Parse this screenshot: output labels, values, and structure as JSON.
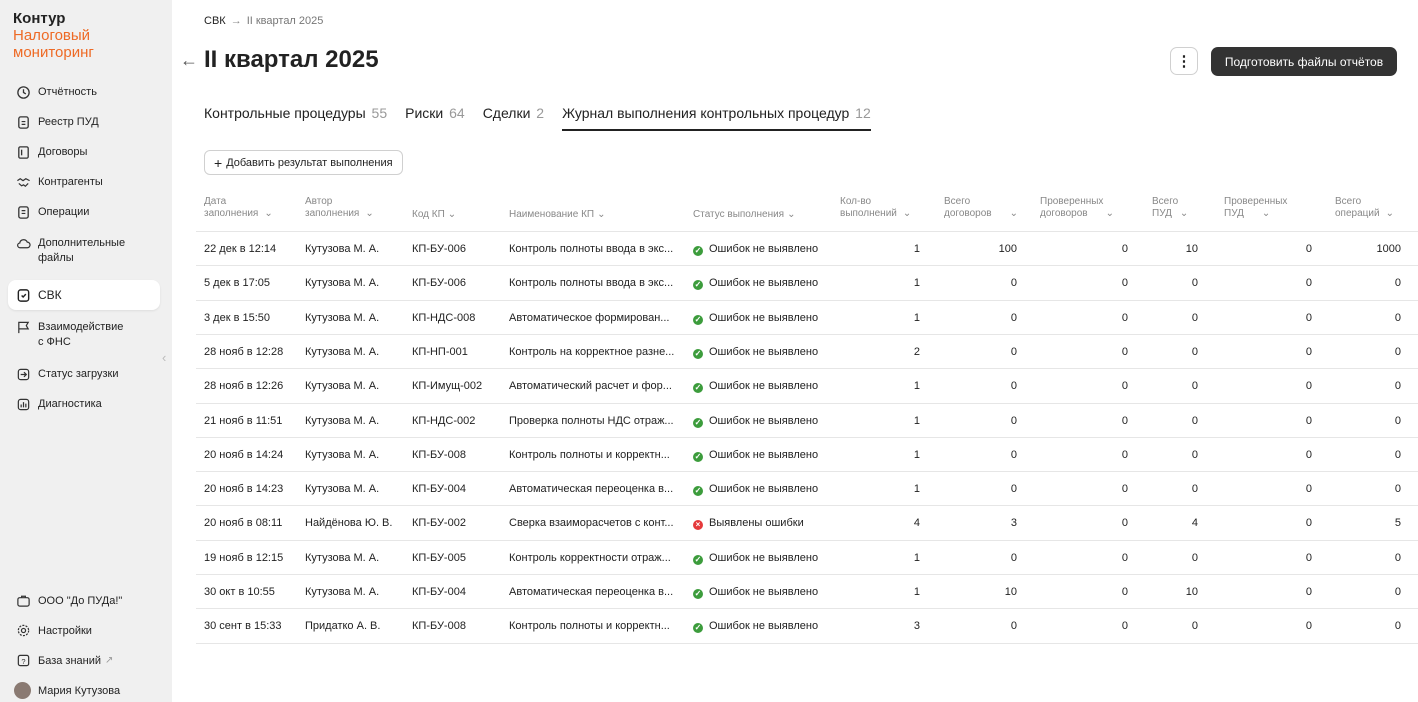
{
  "brand": {
    "line1": "Контур",
    "line2": "Налоговый",
    "line3": "мониторинг"
  },
  "sidebar": {
    "items": [
      {
        "label": "Отчётность",
        "icon": "clock-icon"
      },
      {
        "label": "Реестр ПУД",
        "icon": "document-icon"
      },
      {
        "label": "Договоры",
        "icon": "contract-icon"
      },
      {
        "label": "Контрагенты",
        "icon": "handshake-icon"
      },
      {
        "label": "Операции",
        "icon": "operations-icon"
      },
      {
        "label1": "Дополнительные",
        "label2": "файлы",
        "icon": "cloud-icon"
      },
      {
        "label": "СВК",
        "icon": "svk-icon"
      },
      {
        "label1": "Взаимодействие",
        "label2": "с ФНС",
        "icon": "flag-icon"
      },
      {
        "label": "Статус загрузки",
        "icon": "upload-icon"
      },
      {
        "label": "Диагностика",
        "icon": "chart-icon"
      }
    ],
    "bottom": {
      "org": "ООО \"До ПУДа!\"",
      "settings": "Настройки",
      "knowledge": "База знаний",
      "user": "Мария Кутузова"
    }
  },
  "breadcrumb": {
    "root": "СВК",
    "current": "II квартал 2025"
  },
  "title": "II квартал 2025",
  "actions": {
    "prepare": "Подготовить файлы отчётов"
  },
  "tabs": [
    {
      "label": "Контрольные процедуры",
      "count": "55"
    },
    {
      "label": "Риски",
      "count": "64"
    },
    {
      "label": "Сделки",
      "count": "2"
    },
    {
      "label": "Журнал выполнения контрольных процедур",
      "count": "12"
    }
  ],
  "add_button": "Добавить результат выполнения",
  "headers": [
    [
      "Дата",
      "заполнения"
    ],
    [
      "Автор",
      "заполнения"
    ],
    [
      "Код КП",
      ""
    ],
    [
      "Наименование КП",
      ""
    ],
    [
      "Статус выполнения",
      ""
    ],
    [
      "Кол-во",
      "выполнений"
    ],
    [
      "Всего",
      "договоров"
    ],
    [
      "Проверенных",
      "договоров"
    ],
    [
      "Всего",
      "ПУД"
    ],
    [
      "Проверенных",
      "ПУД"
    ],
    [
      "Всего",
      "операций"
    ]
  ],
  "rows": [
    [
      "22 дек в 12:14",
      "Кутузова М. А.",
      "КП-БУ-006",
      "Контроль полноты ввода в экс...",
      "ok",
      "Ошибок не выявлено",
      "1",
      "100",
      "0",
      "10",
      "0",
      "1000"
    ],
    [
      "5 дек в 17:05",
      "Кутузова М. А.",
      "КП-БУ-006",
      "Контроль полноты ввода в экс...",
      "ok",
      "Ошибок не выявлено",
      "1",
      "0",
      "0",
      "0",
      "0",
      "0"
    ],
    [
      "3 дек в 15:50",
      "Кутузова М. А.",
      "КП-НДС-008",
      "Автоматическое формирован...",
      "ok",
      "Ошибок не выявлено",
      "1",
      "0",
      "0",
      "0",
      "0",
      "0"
    ],
    [
      "28 нояб в 12:28",
      "Кутузова М. А.",
      "КП-НП-001",
      "Контроль на корректное разне...",
      "ok",
      "Ошибок не выявлено",
      "2",
      "0",
      "0",
      "0",
      "0",
      "0"
    ],
    [
      "28 нояб в 12:26",
      "Кутузова М. А.",
      "КП-Имущ-002",
      "Автоматический расчет и фор...",
      "ok",
      "Ошибок не выявлено",
      "1",
      "0",
      "0",
      "0",
      "0",
      "0"
    ],
    [
      "21 нояб в 11:51",
      "Кутузова М. А.",
      "КП-НДС-002",
      "Проверка полноты НДС отраж...",
      "ok",
      "Ошибок не выявлено",
      "1",
      "0",
      "0",
      "0",
      "0",
      "0"
    ],
    [
      "20 нояб в 14:24",
      "Кутузова М. А.",
      "КП-БУ-008",
      "Контроль полноты и корректн...",
      "ok",
      "Ошибок не выявлено",
      "1",
      "0",
      "0",
      "0",
      "0",
      "0"
    ],
    [
      "20 нояб в 14:23",
      "Кутузова М. А.",
      "КП-БУ-004",
      "Автоматическая переоценка в...",
      "ok",
      "Ошибок не выявлено",
      "1",
      "0",
      "0",
      "0",
      "0",
      "0"
    ],
    [
      "20 нояб в 08:11",
      "Найдёнова Ю. В.",
      "КП-БУ-002",
      "Сверка взаиморасчетов с конт...",
      "err",
      "Выявлены ошибки",
      "4",
      "3",
      "0",
      "4",
      "0",
      "5"
    ],
    [
      "19 нояб в 12:15",
      "Кутузова М. А.",
      "КП-БУ-005",
      "Контроль корректности отраж...",
      "ok",
      "Ошибок не выявлено",
      "1",
      "0",
      "0",
      "0",
      "0",
      "0"
    ],
    [
      "30 окт в 10:55",
      "Кутузова М. А.",
      "КП-БУ-004",
      "Автоматическая переоценка в...",
      "ok",
      "Ошибок не выявлено",
      "1",
      "10",
      "0",
      "10",
      "0",
      "0"
    ],
    [
      "30 сент в 15:33",
      "Придатко А. В.",
      "КП-БУ-008",
      "Контроль полноты и корректн...",
      "ok",
      "Ошибок не выявлено",
      "3",
      "0",
      "0",
      "0",
      "0",
      "0"
    ]
  ],
  "colors": {
    "accent": "#ee6a25",
    "ok": "#3c9c3c",
    "error": "#e5393b",
    "primary_button": "#333333"
  }
}
